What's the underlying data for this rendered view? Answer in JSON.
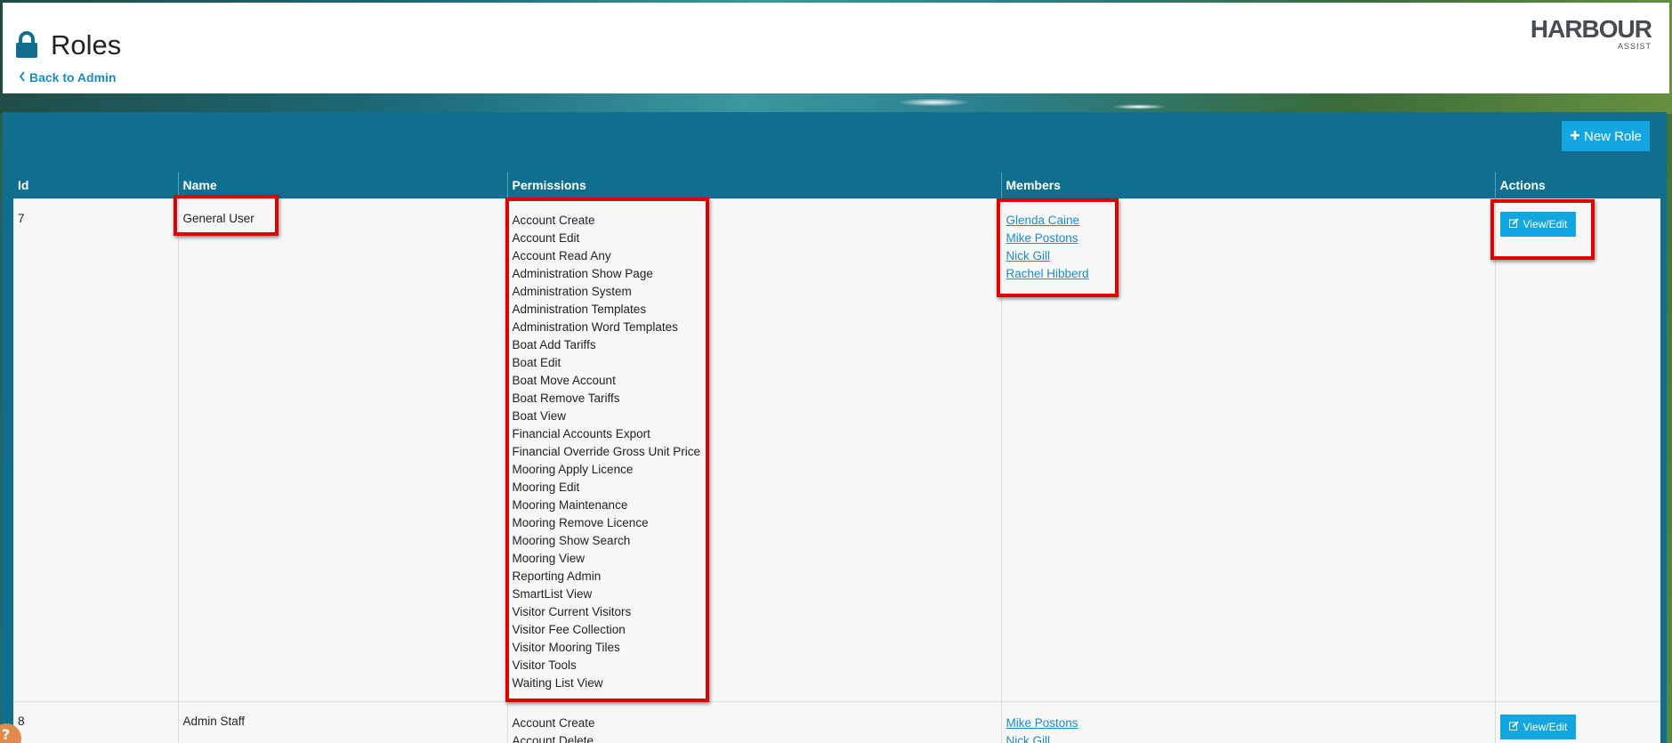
{
  "header": {
    "title": "Roles",
    "back_label": "Back to Admin",
    "logo_main": "HARBOUR",
    "logo_sub": "ASSIST"
  },
  "toolbar": {
    "new_role_label": "New Role"
  },
  "table": {
    "columns": [
      "Id",
      "Name",
      "Permissions",
      "Members",
      "Actions"
    ],
    "rows": [
      {
        "id": "7",
        "name": "General User",
        "permissions": [
          "Account Create",
          "Account Edit",
          "Account Read Any",
          "Administration Show Page",
          "Administration System",
          "Administration Templates",
          "Administration Word Templates",
          "Boat Add Tariffs",
          "Boat Edit",
          "Boat Move Account",
          "Boat Remove Tariffs",
          "Boat View",
          "Financial Accounts Export",
          "Financial Override Gross Unit Price",
          "Mooring Apply Licence",
          "Mooring Edit",
          "Mooring Maintenance",
          "Mooring Remove Licence",
          "Mooring Show Search",
          "Mooring View",
          "Reporting Admin",
          "SmartList View",
          "Visitor Current Visitors",
          "Visitor Fee Collection",
          "Visitor Mooring Tiles",
          "Visitor Tools",
          "Waiting List View"
        ],
        "members": [
          "Glenda Caine",
          "Mike Postons",
          "Nick Gill",
          "Rachel Hibberd"
        ],
        "action_label": "View/Edit"
      },
      {
        "id": "8",
        "name": "Admin Staff",
        "permissions": [
          "Account Create",
          "Account Delete"
        ],
        "members": [
          "Mike Postons",
          "Nick Gill"
        ],
        "action_label": "View/Edit"
      }
    ]
  },
  "colors": {
    "header_bar": "#106f8e",
    "button": "#14a6e0",
    "link": "#1a8cc8",
    "highlight": "#e00000"
  },
  "icons": [
    "lock-icon",
    "chevron-left-icon",
    "plus-icon",
    "edit-icon",
    "help-icon"
  ]
}
